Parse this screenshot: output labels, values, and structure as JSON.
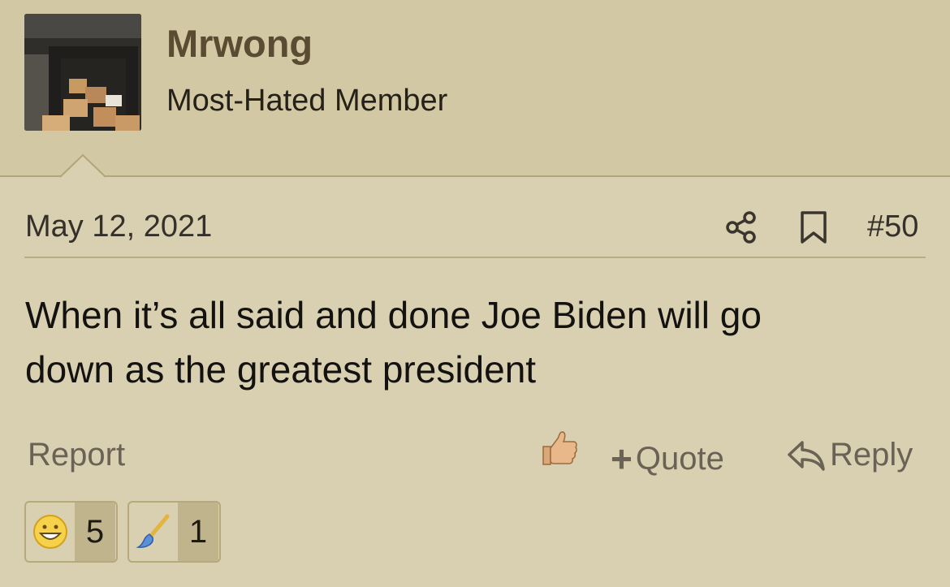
{
  "user": {
    "name": "Mrwong",
    "title": "Most-Hated Member"
  },
  "post": {
    "date": "May 12, 2021",
    "number": "#50",
    "body_line1": "When it’s all said and done Joe Biden will go",
    "body_line2": "down as the greatest president"
  },
  "actions": {
    "report": "Report",
    "quote": "Quote",
    "quote_prefix": "+",
    "reply": "Reply"
  },
  "reactions": [
    {
      "icon": "grinning-face-icon",
      "count": "5"
    },
    {
      "icon": "paintbrush-icon",
      "count": "1"
    }
  ],
  "colors": {
    "background": "#d8d0b0",
    "header_background": "#d2c9a4",
    "username": "#5a4c32",
    "action_text": "#6a6254"
  }
}
